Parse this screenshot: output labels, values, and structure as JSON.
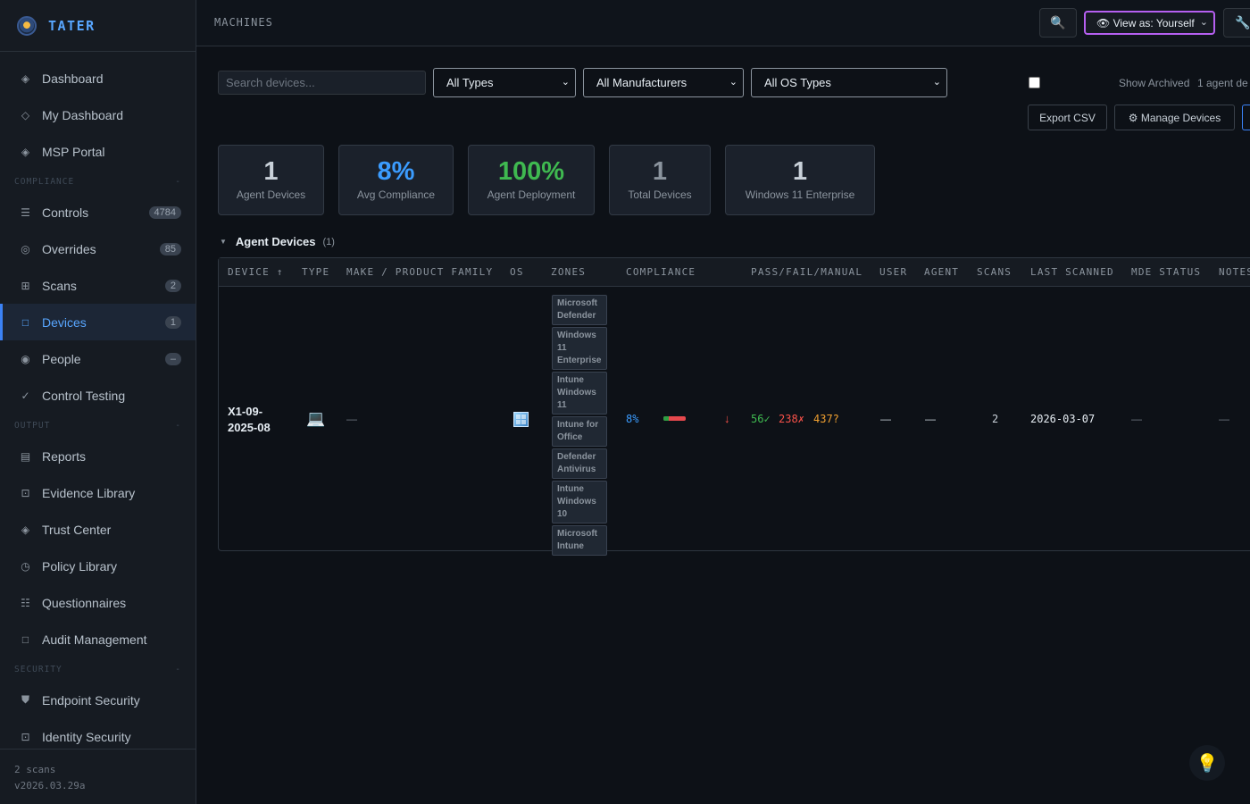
{
  "brand": {
    "name": "TATER"
  },
  "nav": {
    "top": [
      {
        "label": "Dashboard",
        "icon": "diamond-icon"
      },
      {
        "label": "My Dashboard",
        "icon": "diamond-outline-icon"
      },
      {
        "label": "MSP Portal",
        "icon": "diamond-icon"
      }
    ],
    "compliance_label": "COMPLIANCE",
    "compliance": [
      {
        "label": "Controls",
        "icon": "list-icon",
        "badge": "4784"
      },
      {
        "label": "Overrides",
        "icon": "circle-icon",
        "badge": "85"
      },
      {
        "label": "Scans",
        "icon": "grid-icon",
        "badge": "2"
      },
      {
        "label": "Devices",
        "icon": "square-icon",
        "badge": "1",
        "active": true
      },
      {
        "label": "People",
        "icon": "person-icon",
        "badge": "–"
      },
      {
        "label": "Control Testing",
        "icon": "check-icon"
      }
    ],
    "output_label": "OUTPUT",
    "output": [
      {
        "label": "Reports",
        "icon": "report-icon"
      },
      {
        "label": "Evidence Library",
        "icon": "evidence-icon"
      },
      {
        "label": "Trust Center",
        "icon": "diamond-icon"
      },
      {
        "label": "Policy Library",
        "icon": "clock-icon"
      },
      {
        "label": "Questionnaires",
        "icon": "checklist-icon"
      },
      {
        "label": "Audit Management",
        "icon": "square-icon"
      }
    ],
    "security_label": "SECURITY",
    "security": [
      {
        "label": "Endpoint Security",
        "icon": "shield-icon"
      },
      {
        "label": "Identity Security",
        "icon": "identity-icon"
      }
    ],
    "section_toggle": "-"
  },
  "footer": {
    "scans": "2 scans",
    "version": "v2026.03.29a"
  },
  "topbar": {
    "crumb": "MACHINES",
    "search_icon": "🔍",
    "view_as": "👁 View as: Yourself",
    "wrench_icon": "🔧"
  },
  "filters": {
    "search_placeholder": "Search devices...",
    "type": "All Types",
    "manufacturer": "All Manufacturers",
    "os": "All OS Types",
    "show_archived": "Show Archived",
    "count": "1 agent de",
    "export_csv": "Export CSV",
    "manage_devices": "⚙ Manage Devices"
  },
  "stats": [
    {
      "value": "1",
      "label": "Agent Devices",
      "color": "#c9d1d9"
    },
    {
      "value": "8%",
      "label": "Avg Compliance",
      "color": "#3b9cff"
    },
    {
      "value": "100%",
      "label": "Agent Deployment",
      "color": "#3fb950"
    },
    {
      "value": "1",
      "label": "Total Devices",
      "color": "#8b949e"
    },
    {
      "value": "1",
      "label": "Windows 11 Enterprise",
      "color": "#c9d1d9"
    }
  ],
  "group": {
    "title": "Agent Devices",
    "count": "(1)"
  },
  "table": {
    "columns": [
      "DEVICE ↑",
      "TYPE",
      "MAKE / PRODUCT FAMILY",
      "OS",
      "ZONES",
      "COMPLIANCE",
      "PASS/FAIL/MANUAL",
      "USER",
      "AGENT",
      "SCANS",
      "LAST SCANNED",
      "MDE STATUS",
      "NOTES"
    ],
    "row": {
      "device": "X1-09-2025-08",
      "type_icon": "💻",
      "make": "—",
      "zones": [
        "Microsoft Defender",
        "Windows 11 Enterprise",
        "Intune Windows 11",
        "Intune for Office",
        "Defender Antivirus",
        "Intune Windows 10",
        "Microsoft Intune"
      ],
      "compliance": "8%",
      "compliance_fraction": 0.08,
      "trend": "↓",
      "pass": "56✓",
      "fail": "238✗",
      "manual": "437?",
      "user": "—",
      "agent": "—",
      "scans": "2",
      "last_scanned": "2026-03-07",
      "mde_status": "—",
      "notes": "—"
    }
  },
  "colors": {
    "accent": "#3b82f6",
    "pass": "#3fb950",
    "fail": "#f85149",
    "manual": "#f0a030",
    "view_as_border": "#b55ff0"
  },
  "fab_icon": "💡"
}
